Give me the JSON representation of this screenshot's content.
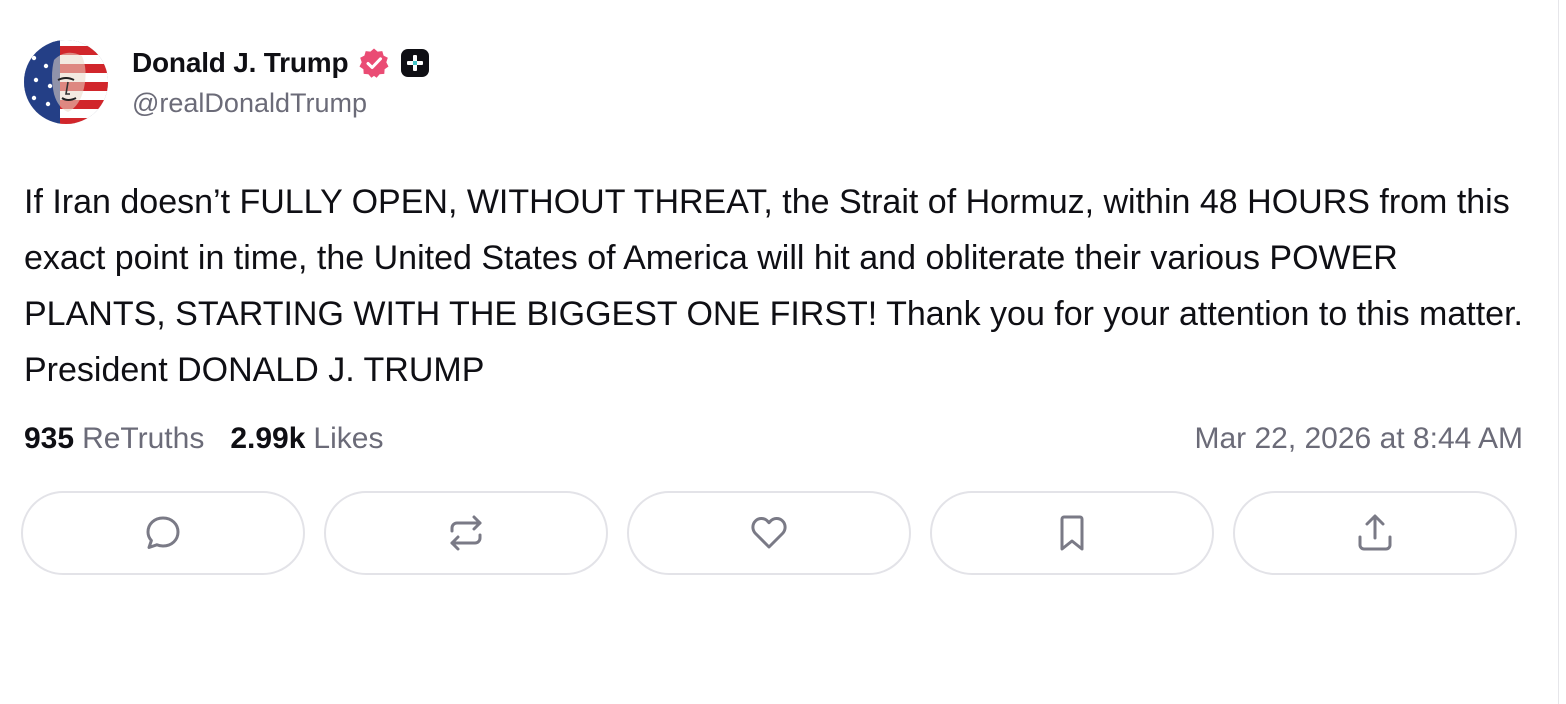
{
  "post": {
    "author": {
      "display_name": "Donald J. Trump",
      "handle": "@realDonaldTrump",
      "verified_icon": "verified-badge-icon",
      "plus_icon": "plus-badge-icon"
    },
    "text": "If Iran doesn’t FULLY OPEN, WITHOUT THREAT, the Strait of Hormuz, within 48 HOURS from this exact point in time, the United States of America will hit and obliterate their various POWER PLANTS, STARTING WITH THE BIGGEST ONE FIRST! Thank you for your attention to this matter. President DONALD J. TRUMP",
    "stats": {
      "retruths_count": "935",
      "retruths_label": "ReTruths",
      "likes_count": "2.99k",
      "likes_label": "Likes"
    },
    "timestamp": "Mar 22, 2026 at 8:44 AM"
  },
  "actions": [
    {
      "name": "reply",
      "icon": "comment-icon"
    },
    {
      "name": "retruth",
      "icon": "repost-icon"
    },
    {
      "name": "like",
      "icon": "heart-icon"
    },
    {
      "name": "bookmark",
      "icon": "bookmark-icon"
    },
    {
      "name": "share",
      "icon": "share-icon"
    }
  ],
  "colors": {
    "verified_badge": "#ea4c74",
    "icon_gray": "#7a7a86",
    "text_primary": "#0f0f14",
    "text_secondary": "#6b6b78"
  }
}
